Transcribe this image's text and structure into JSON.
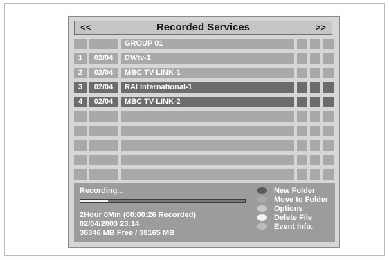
{
  "header": {
    "prev": "<<",
    "title": "Recorded Services",
    "next": ">>"
  },
  "list": {
    "group": "GROUP 01",
    "rows": [
      {
        "num": "1",
        "date": "02/04",
        "name": "DWtv-1",
        "selected": false
      },
      {
        "num": "2",
        "date": "02/04",
        "name": "MBC TV-LINK-1",
        "selected": false
      },
      {
        "num": "3",
        "date": "02/04",
        "name": "RAI International-1",
        "selected": true
      },
      {
        "num": "4",
        "date": "02/04",
        "name": "MBC TV-LINK-2",
        "selected": true
      },
      {
        "num": "",
        "date": "",
        "name": "",
        "selected": false
      },
      {
        "num": "",
        "date": "",
        "name": "",
        "selected": false
      },
      {
        "num": "",
        "date": "",
        "name": "",
        "selected": false
      },
      {
        "num": "",
        "date": "",
        "name": "",
        "selected": false
      },
      {
        "num": "",
        "date": "",
        "name": "",
        "selected": false
      },
      {
        "num": "",
        "date": "",
        "name": "",
        "selected": false
      }
    ]
  },
  "info": {
    "status": "Recording...",
    "progress": 0.17,
    "duration": "2Hour 0Min (00:00:26 Recorded)",
    "datetime": "02/04/2003 23:14",
    "disk": "36346 MB Free / 38165 MB"
  },
  "legend": [
    {
      "label": "New Folder",
      "color": "#5a5a5a",
      "icon": "dark-grey-key-icon"
    },
    {
      "label": "Move to Folder",
      "color": "#aaaaaa",
      "icon": "grey-key-icon"
    },
    {
      "label": "Options",
      "color": "#c8c8c8",
      "icon": "light-grey-key-icon"
    },
    {
      "label": "Delete File",
      "color": "#f2f2f2",
      "icon": "white-key-icon"
    },
    {
      "label": "Event Info.",
      "color": "#bdbdbd",
      "icon": "silver-key-icon"
    }
  ]
}
